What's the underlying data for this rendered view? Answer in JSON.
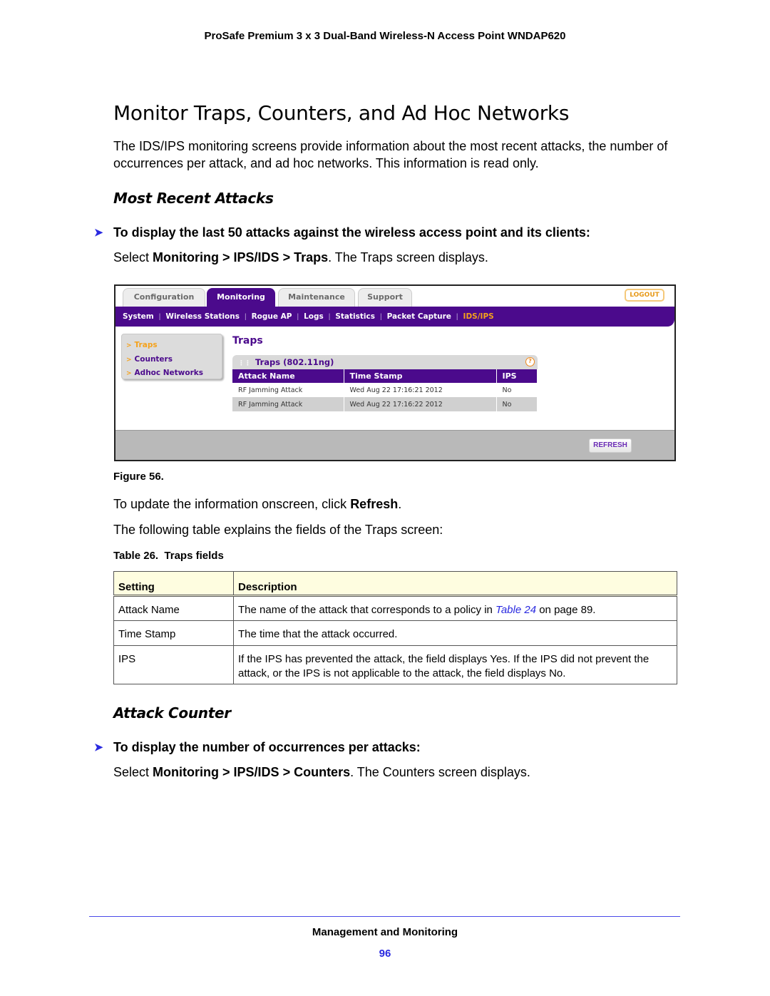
{
  "running_header": "ProSafe Premium 3 x 3 Dual-Band Wireless-N Access Point WNDAP620",
  "title": "Monitor Traps, Counters, and Ad Hoc Networks",
  "intro": "The IDS/IPS monitoring screens provide information about the most recent attacks, the number of occurrences per attack, and ad hoc networks. This information is read only.",
  "section1": {
    "heading": "Most Recent Attacks",
    "procedure": "To display the last 50 attacks against the wireless access point and its clients:",
    "step": {
      "prefix": "Select ",
      "menu1": "Monitoring",
      "sep1": " > ",
      "menu2": "IPS/IDS",
      "sep2": " > ",
      "menu3": "Traps",
      "suffix": ". The Traps screen displays."
    }
  },
  "screenshot": {
    "tabs": [
      "Configuration",
      "Monitoring",
      "Maintenance",
      "Support"
    ],
    "active_tab": "Monitoring",
    "logout_label": "LOGOUT",
    "subnav": [
      "System",
      "Wireless Stations",
      "Rogue AP",
      "Logs",
      "Statistics",
      "Packet Capture",
      "IDS/IPS"
    ],
    "active_subnav": "IDS/IPS",
    "leftnav": [
      "Traps",
      "Counters",
      "Adhoc Networks"
    ],
    "active_leftnav": "Traps",
    "section_title": "Traps",
    "panel_title": "Traps (802.11ng)",
    "help_icon": "?",
    "columns": [
      "Attack Name",
      "Time Stamp",
      "IPS"
    ],
    "rows": [
      [
        "RF Jamming Attack",
        "Wed Aug 22 17:16:21 2012",
        "No"
      ],
      [
        "RF Jamming Attack",
        "Wed Aug 22 17:16:22 2012",
        "No"
      ]
    ],
    "refresh_label": "REFRESH",
    "colors": {
      "brand_purple": "#4b0a8c",
      "accent_orange": "#f5a21b"
    }
  },
  "figure_caption": "Figure 56.",
  "refresh_para": {
    "prefix": "To update the information onscreen, click ",
    "bold": "Refresh",
    "suffix": "."
  },
  "table_intro": "The following table explains the fields of the Traps screen:",
  "table_caption": "Table 26.  Traps fields",
  "fields_table": {
    "headers": [
      "Setting",
      "Description"
    ],
    "rows": [
      {
        "setting": "Attack Name",
        "desc_prefix": "The name of the attack that corresponds to a policy in ",
        "desc_link": "Table 24",
        "desc_suffix": " on page 89."
      },
      {
        "setting": "Time Stamp",
        "description": "The time that the attack occurred."
      },
      {
        "setting": "IPS",
        "description": "If the IPS has prevented the attack, the field displays Yes. If the IPS did not prevent the attack, or the IPS is not applicable to the attack, the field displays No."
      }
    ]
  },
  "section2": {
    "heading": "Attack Counter",
    "procedure": "To display the number of occurrences per attacks:",
    "step": {
      "prefix": "Select ",
      "menu1": "Monitoring",
      "sep1": " > ",
      "menu2": "IPS/IDS",
      "sep2": " > ",
      "menu3": "Counters",
      "suffix": ". The Counters screen displays."
    }
  },
  "footer": {
    "title": "Management and Monitoring",
    "page": "96"
  }
}
